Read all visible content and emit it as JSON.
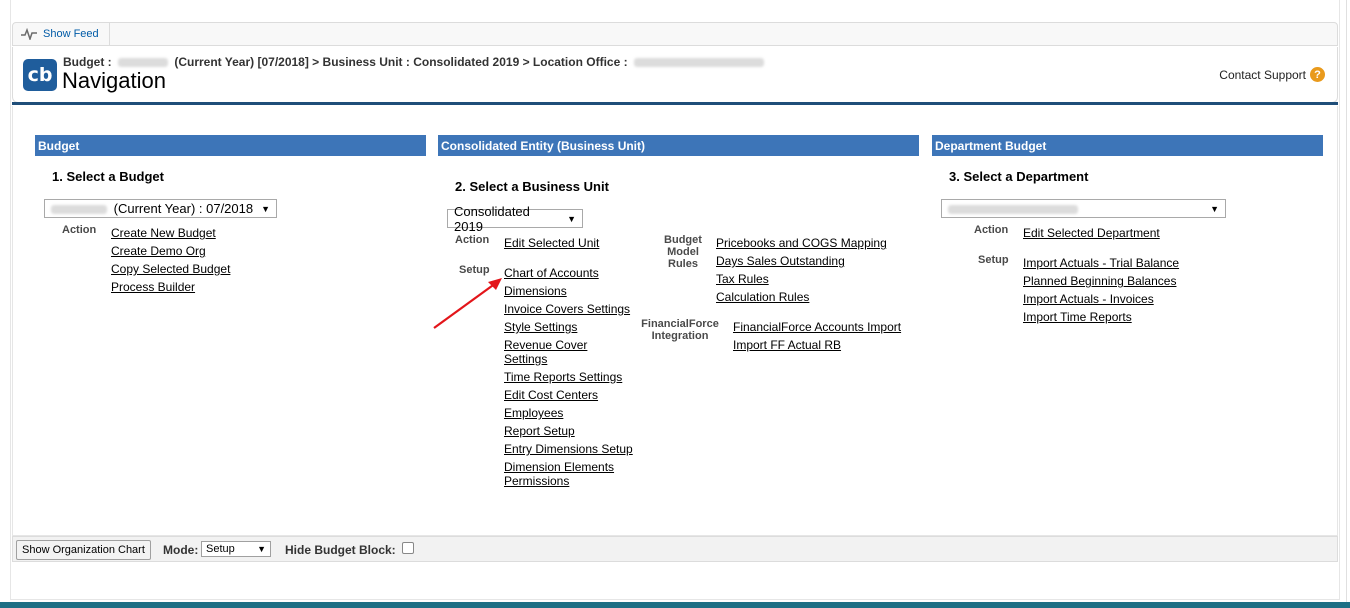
{
  "feed": {
    "show_feed": "Show Feed"
  },
  "header": {
    "breadcrumb_prefix": "Budget :",
    "breadcrumb_mid": "(Current Year) [07/2018] > Business Unit : Consolidated 2019 > Location Office :",
    "title": "Navigation",
    "logo": "cb",
    "contact_support": "Contact Support",
    "help_icon": "?"
  },
  "columns": {
    "budget": {
      "header": "Budget",
      "step": "1. Select a Budget",
      "select_value": "(Current Year) : 07/2018",
      "action_label": "Action",
      "actions": [
        "Create New Budget",
        "Create Demo Org",
        "Copy Selected Budget",
        "Process Builder"
      ]
    },
    "business_unit": {
      "header": "Consolidated Entity (Business Unit)",
      "step": "2. Select a Business Unit",
      "select_value": "Consolidated 2019",
      "action_label": "Action",
      "actions": [
        "Edit Selected Unit"
      ],
      "setup_label": "Setup",
      "setup": [
        "Chart of Accounts",
        "Dimensions",
        "Invoice Covers Settings",
        "Style Settings",
        "Revenue Cover Settings",
        "Time Reports Settings",
        "Edit Cost Centers",
        "Employees",
        "Report Setup",
        "Entry Dimensions Setup",
        "Dimension Elements Permissions"
      ],
      "budget_model_label": "Budget Model Rules",
      "budget_model": [
        "Pricebooks and COGS Mapping",
        "Days Sales Outstanding",
        "Tax Rules",
        "Calculation Rules"
      ],
      "ff_label": "FinancialForce Integration",
      "ff": [
        "FinancialForce Accounts Import",
        "Import FF Actual RB"
      ]
    },
    "department": {
      "header": "Department Budget",
      "step": "3. Select a Department",
      "action_label": "Action",
      "actions": [
        "Edit Selected Department"
      ],
      "setup_label": "Setup",
      "setup": [
        "Import Actuals - Trial Balance",
        "Planned Beginning Balances",
        "Import Actuals - Invoices",
        "Import Time Reports"
      ]
    }
  },
  "footer": {
    "org_chart_button": "Show Organization Chart",
    "mode_label": "Mode:",
    "mode_value": "Setup",
    "hide_budget_label": "Hide Budget Block:"
  },
  "colors": {
    "column_header": "#3d75b8",
    "header_line": "#1f4e79",
    "bottom_bar": "#1d6f85",
    "arrow": "#e3151a"
  }
}
